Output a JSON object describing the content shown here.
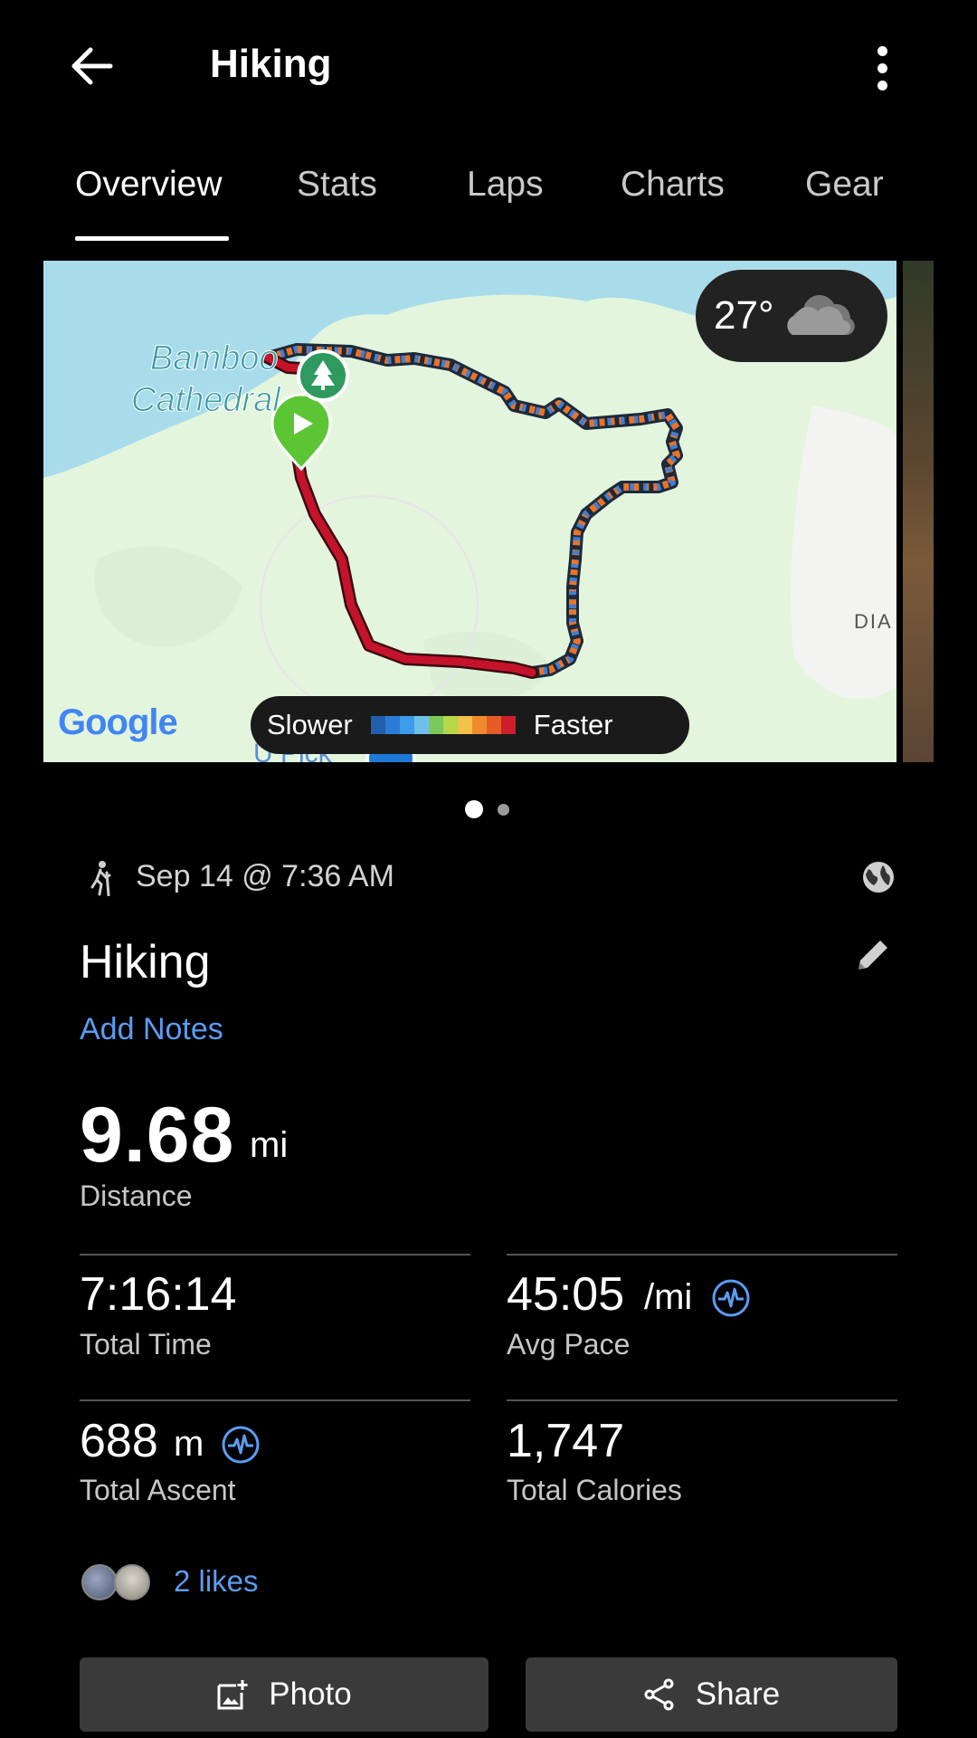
{
  "header": {
    "title": "Hiking",
    "back_icon": "back-arrow-icon",
    "more_icon": "more-vertical-icon"
  },
  "tabs": [
    {
      "label": "Overview",
      "active": true
    },
    {
      "label": "Stats",
      "active": false
    },
    {
      "label": "Laps",
      "active": false
    },
    {
      "label": "Charts",
      "active": false
    },
    {
      "label": "Gear",
      "active": false
    }
  ],
  "map": {
    "place_label_1": "Bamboo",
    "place_label_2": "Cathedral",
    "edge_label": "DIA",
    "bottom_road_label": "U Pick",
    "google_logo": "Google",
    "weather": {
      "temp": "27°",
      "icon": "cloud-icon"
    },
    "legend": {
      "slower": "Slower",
      "faster": "Faster",
      "colors": [
        "#1f5fae",
        "#2b7bd6",
        "#3d9be9",
        "#6ec0ea",
        "#7cc95b",
        "#b4d84a",
        "#f2c14a",
        "#ef8a2f",
        "#e45d26",
        "#cc1e2b"
      ]
    },
    "track_color": "#c4132a"
  },
  "pager": {
    "count": 2,
    "active": 0
  },
  "activity": {
    "icon": "hiker-icon",
    "date": "Sep 14 @ 7:36 AM",
    "privacy_icon": "globe-icon",
    "name": "Hiking",
    "edit_icon": "pencil-icon",
    "add_notes": "Add Notes"
  },
  "distance": {
    "value": "9.68",
    "unit": "mi",
    "label": "Distance"
  },
  "stats": {
    "total_time": {
      "value": "7:16:14",
      "label": "Total Time"
    },
    "avg_pace": {
      "value": "45:05",
      "unit": "/mi",
      "label": "Avg Pace",
      "icon": "pulse-icon"
    },
    "total_ascent": {
      "value": "688",
      "unit": "m",
      "label": "Total Ascent",
      "icon": "pulse-icon"
    },
    "total_calories": {
      "value": "1,747",
      "label": "Total Calories"
    }
  },
  "likes": {
    "text": "2 likes"
  },
  "buttons": {
    "photo": "Photo",
    "share": "Share"
  },
  "colors": {
    "accent_blue": "#5b9cf2",
    "button_bg": "#3a3a3a",
    "background": "#000000"
  }
}
